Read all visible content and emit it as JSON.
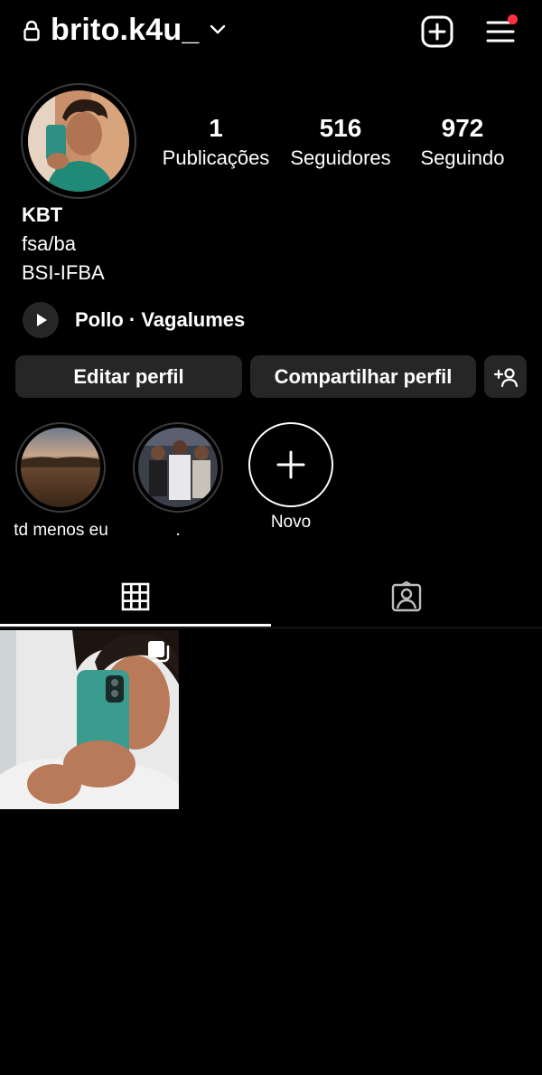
{
  "header": {
    "username": "brito.k4u_",
    "icons": {
      "lock": "lock-icon",
      "chevron": "chevron-down-icon",
      "new_post": "plus-square-icon",
      "menu": "hamburger-menu-icon"
    },
    "notification_dot_color": "#ff3040"
  },
  "profile": {
    "stats": [
      {
        "value": "1",
        "label": "Publicações"
      },
      {
        "value": "516",
        "label": "Seguidores"
      },
      {
        "value": "972",
        "label": "Seguindo"
      }
    ],
    "name": "KBT",
    "bio_lines": [
      "fsa/ba",
      "BSI-IFBA"
    ],
    "music": "Pollo · Vagalumes"
  },
  "actions": {
    "edit": "Editar perfil",
    "share": "Compartilhar perfil",
    "add_person_icon": "add-person-icon"
  },
  "highlights": [
    {
      "label": "td menos eu"
    },
    {
      "label": "."
    },
    {
      "label": "Novo"
    }
  ],
  "tabs": [
    {
      "icon": "grid-icon",
      "active": true
    },
    {
      "icon": "tagged-person-icon",
      "active": false
    }
  ],
  "colors": {
    "background": "#000000",
    "button_bg": "#262626",
    "text": "#ffffff"
  }
}
